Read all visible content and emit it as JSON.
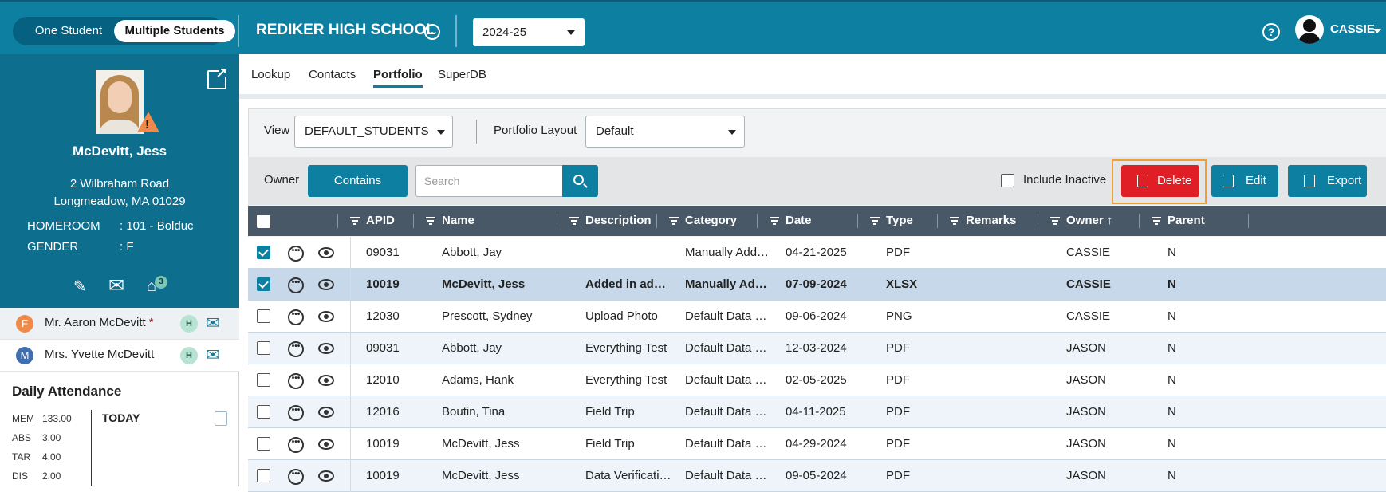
{
  "topbar": {
    "toggle_one": "One Student",
    "toggle_multi": "Multiple Students",
    "school": "REDIKER HIGH SCHOOL",
    "school_more": "…",
    "year": "2024-25",
    "help": "?",
    "user": "CASSIE"
  },
  "student": {
    "name": "McDevitt, Jess",
    "address1": "2 Wilbraham Road",
    "address2": "Longmeadow, MA 01029",
    "homeroom_label": "HOMEROOM",
    "homeroom_value": ": 101 - Bolduc",
    "gender_label": "GENDER",
    "gender_value": ": F",
    "household_count": "3",
    "warn_mark": "!"
  },
  "contacts": [
    {
      "initial": "F",
      "name": "Mr. Aaron McDevitt",
      "required": "*",
      "badge": "H",
      "color": "#f08a4b"
    },
    {
      "initial": "M",
      "name": "Mrs. Yvette McDevitt",
      "required": "",
      "badge": "H",
      "color": "#3f6fb0"
    }
  ],
  "attendance": {
    "title": "Daily Attendance",
    "today": "TODAY",
    "rows": [
      {
        "label": "MEM",
        "value": "133.00"
      },
      {
        "label": "ABS",
        "value": "3.00"
      },
      {
        "label": "TAR",
        "value": "4.00"
      },
      {
        "label": "DIS",
        "value": "2.00"
      }
    ]
  },
  "tabs": [
    "Lookup",
    "Contacts",
    "Portfolio",
    "SuperDB"
  ],
  "active_tab": "Portfolio",
  "filters": {
    "view_label": "View",
    "view_value": "DEFAULT_STUDENTS",
    "layout_label": "Portfolio Layout",
    "layout_value": "Default",
    "owner_label": "Owner",
    "contains": "Contains",
    "search_placeholder": "Search",
    "include_inactive": "Include Inactive",
    "delete": "Delete",
    "edit": "Edit",
    "export": "Export"
  },
  "grid": {
    "columns": [
      "APID",
      "Name",
      "Description",
      "Category",
      "Date",
      "Type",
      "Remarks",
      "Owner ↑",
      "Parent"
    ],
    "rows": [
      {
        "checked": true,
        "selected": false,
        "apid": "09031",
        "name": "Abbott, Jay",
        "description": "",
        "category": "Manually Add…",
        "date": "04-21-2025",
        "type": "PDF",
        "remarks": "",
        "owner": "CASSIE",
        "parent": "N"
      },
      {
        "checked": true,
        "selected": true,
        "apid": "10019",
        "name": "McDevitt, Jess",
        "description": "Added in ad…",
        "category": "Manually Ad…",
        "date": "07-09-2024",
        "type": "XLSX",
        "remarks": "",
        "owner": "CASSIE",
        "parent": "N"
      },
      {
        "checked": false,
        "selected": false,
        "apid": "12030",
        "name": "Prescott, Sydney",
        "description": "Upload Photo",
        "category": "Default Data …",
        "date": "09-06-2024",
        "type": "PNG",
        "remarks": "",
        "owner": "CASSIE",
        "parent": "N"
      },
      {
        "checked": false,
        "selected": false,
        "apid": "09031",
        "name": "Abbott, Jay",
        "description": "Everything Test",
        "category": "Default Data …",
        "date": "12-03-2024",
        "type": "PDF",
        "remarks": "",
        "owner": "JASON",
        "parent": "N"
      },
      {
        "checked": false,
        "selected": false,
        "apid": "12010",
        "name": "Adams, Hank",
        "description": "Everything Test",
        "category": "Default Data …",
        "date": "02-05-2025",
        "type": "PDF",
        "remarks": "",
        "owner": "JASON",
        "parent": "N"
      },
      {
        "checked": false,
        "selected": false,
        "apid": "12016",
        "name": "Boutin, Tina",
        "description": "Field Trip",
        "category": "Default Data …",
        "date": "04-11-2025",
        "type": "PDF",
        "remarks": "",
        "owner": "JASON",
        "parent": "N"
      },
      {
        "checked": false,
        "selected": false,
        "apid": "10019",
        "name": "McDevitt, Jess",
        "description": "Field Trip",
        "category": "Default Data …",
        "date": "04-29-2024",
        "type": "PDF",
        "remarks": "",
        "owner": "JASON",
        "parent": "N"
      },
      {
        "checked": false,
        "selected": false,
        "apid": "10019",
        "name": "McDevitt, Jess",
        "description": "Data Verificati…",
        "category": "Default Data …",
        "date": "09-05-2024",
        "type": "PDF",
        "remarks": "",
        "owner": "JASON",
        "parent": "N"
      }
    ]
  },
  "colors": {
    "brand": "#0d7fa1",
    "delete": "#e01e26",
    "highlight": "#f0a030"
  },
  "icons": [
    "help-icon",
    "user-avatar-icon",
    "popout-icon",
    "warning-icon",
    "edit-icon",
    "mail-icon",
    "home-icon",
    "search-icon",
    "trash-icon",
    "export-icon",
    "more-icon",
    "eye-icon",
    "filter-icon",
    "document-icon"
  ]
}
